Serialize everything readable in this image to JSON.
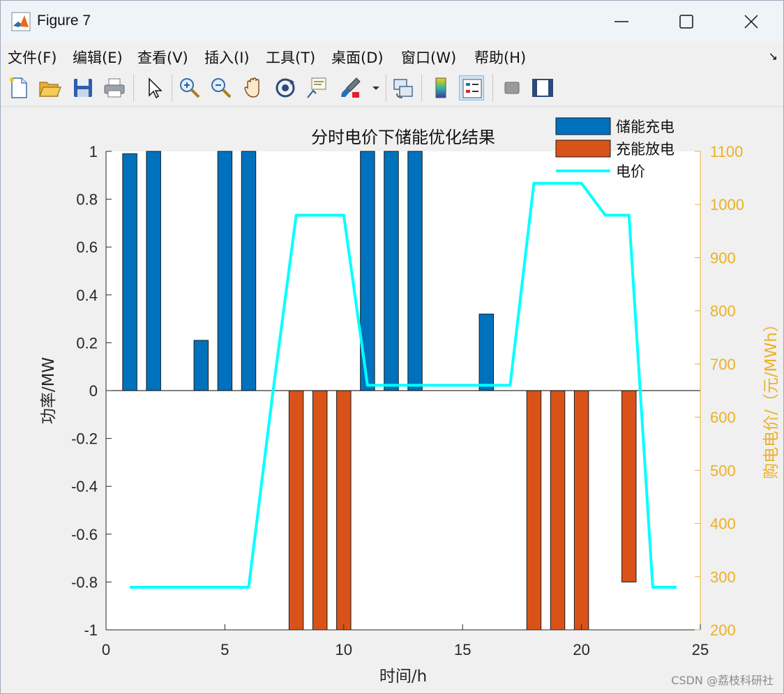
{
  "window": {
    "title": "Figure 7"
  },
  "menu": [
    "文件(F)",
    "编辑(E)",
    "查看(V)",
    "插入(I)",
    "工具(T)",
    "桌面(D)",
    "窗口(W)",
    "帮助(H)"
  ],
  "toolbar": {
    "icons": [
      "new-figure-icon",
      "open-icon",
      "save-icon",
      "print-icon",
      "pointer-icon",
      "zoom-in-icon",
      "zoom-out-icon",
      "pan-icon",
      "rotate-3d-icon",
      "data-cursor-icon",
      "brush-icon",
      "brush-dropdown-icon",
      "link-plot-icon",
      "colorbar-icon",
      "legend-icon",
      "hide-plot-tools-icon",
      "show-plot-tools-icon"
    ]
  },
  "watermark": "CSDN @荔枝科研社",
  "chart_data": {
    "type": "bar",
    "title": "分时电价下储能优化结果",
    "xlabel": "时间/h",
    "ylabel": "功率/MW",
    "ylabel_right": "购电电价/（元/MWh）",
    "xlim": [
      0,
      25
    ],
    "ylim": [
      -1,
      1
    ],
    "ylim_right": [
      200,
      1100
    ],
    "xticks": [
      "0",
      "5",
      "10",
      "15",
      "20",
      "25"
    ],
    "yticks": [
      "-1",
      "-0.8",
      "-0.6",
      "-0.4",
      "-0.2",
      "0",
      "0.2",
      "0.4",
      "0.6",
      "0.8",
      "1"
    ],
    "yticks_right": [
      "200",
      "300",
      "400",
      "500",
      "600",
      "700",
      "800",
      "900",
      "1000",
      "1100"
    ],
    "x": [
      1,
      2,
      3,
      4,
      5,
      6,
      7,
      8,
      9,
      10,
      11,
      12,
      13,
      14,
      15,
      16,
      17,
      18,
      19,
      20,
      21,
      22,
      23,
      24
    ],
    "series": [
      {
        "name": "储能充电",
        "type": "bar",
        "axis": "left",
        "color": "#0072BD",
        "values": [
          0.99,
          1,
          0,
          0.21,
          1,
          1,
          0,
          0,
          0,
          0,
          1,
          1,
          1,
          0,
          0,
          0.32,
          0,
          0,
          0,
          0,
          0,
          0,
          0,
          0
        ]
      },
      {
        "name": "充能放电",
        "type": "bar",
        "axis": "left",
        "color": "#D95319",
        "values": [
          0,
          0,
          0,
          0,
          0,
          0,
          0,
          -1,
          -1,
          -1,
          0,
          0,
          0,
          0,
          0,
          0,
          0,
          -1,
          -1,
          -1,
          0,
          -0.8,
          0,
          0
        ]
      },
      {
        "name": "电价",
        "type": "line",
        "axis": "right",
        "color": "#00FFFF",
        "values": [
          280,
          280,
          280,
          280,
          280,
          280,
          640,
          980,
          980,
          980,
          660,
          660,
          660,
          660,
          660,
          660,
          660,
          1040,
          1040,
          1040,
          980,
          980,
          280,
          280
        ]
      }
    ],
    "legend": "top-right",
    "grid": false,
    "colors": {
      "right_axis": "#EDB120",
      "left_axis": "#262626"
    }
  }
}
